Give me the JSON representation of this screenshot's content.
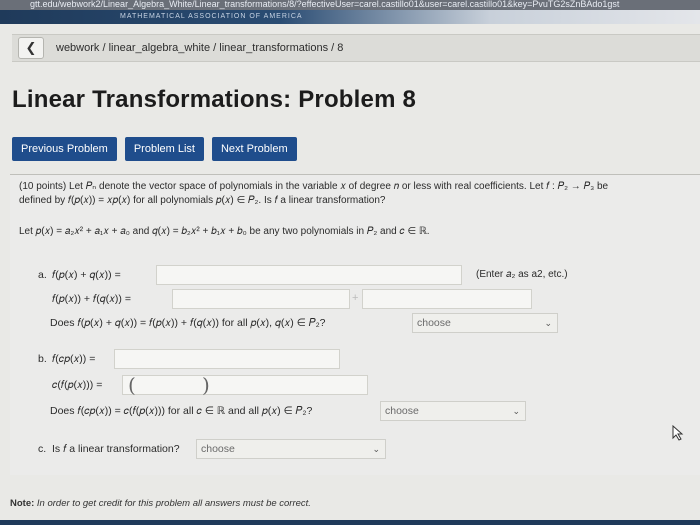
{
  "browser": {
    "url": "gtt.edu/webwork2/Linear_Algebra_White/Linear_transformations/8/?effectiveUser=carel.castillo01&user=carel.castillo01&key=PvuTG2sZnBAdo1gst"
  },
  "header": {
    "banner_text": "MATHEMATICAL ASSOCIATION OF AMERICA",
    "breadcrumb": "webwork / linear_algebra_white / linear_transformations / 8",
    "title": "Linear Transformations: Problem 8"
  },
  "nav": {
    "previous": "Previous Problem",
    "list": "Problem List",
    "next": "Next Problem"
  },
  "problem": {
    "line1": "(10 points) Let 𝑃ₙ denote the vector space of polynomials in the variable 𝑥 of degree 𝑛 or less with real coefficients. Let 𝑓 : 𝑃₂ → 𝑃₃ be",
    "line2": "defined by 𝑓(𝑝(𝑥)) = 𝑥𝑝(𝑥) for all polynomials 𝑝(𝑥) ∈ 𝑃₂. Is 𝑓 a linear transformation?",
    "line3": "Let 𝑝(𝑥) = 𝑎₂𝑥² + 𝑎₁𝑥 + 𝑎₀ and 𝑞(𝑥) = 𝑏₂𝑥² + 𝑏₁𝑥 + 𝑏₀ be any two polynomials in 𝑃₂ and 𝑐 ∈ ℝ.",
    "part_a": {
      "label": "a.",
      "row1": "𝑓(𝑝(𝑥) + 𝑞(𝑥)) =",
      "hint": "(Enter 𝑎₂ as a2, etc.)",
      "row2": "𝑓(𝑝(𝑥)) + 𝑓(𝑞(𝑥)) =",
      "plus": "+",
      "question": "Does 𝑓(𝑝(𝑥) + 𝑞(𝑥)) = 𝑓(𝑝(𝑥)) + 𝑓(𝑞(𝑥)) for all 𝑝(𝑥), 𝑞(𝑥) ∈ 𝑃₂?",
      "select": "choose"
    },
    "part_b": {
      "label": "b.",
      "row1": "𝑓(𝑐𝑝(𝑥)) =",
      "row2": "𝑐(𝑓(𝑝(𝑥))) =",
      "open_paren": "(",
      "close_paren": ")",
      "question": "Does 𝑓(𝑐𝑝(𝑥)) = 𝑐(𝑓(𝑝(𝑥))) for all 𝑐 ∈ ℝ and all 𝑝(𝑥) ∈ 𝑃₂?",
      "select": "choose"
    },
    "part_c": {
      "label": "c.",
      "question": "Is 𝑓 a linear transformation?",
      "select": "choose"
    },
    "note_label": "Note:",
    "note_text": "In order to get credit for this problem all answers must be correct."
  }
}
